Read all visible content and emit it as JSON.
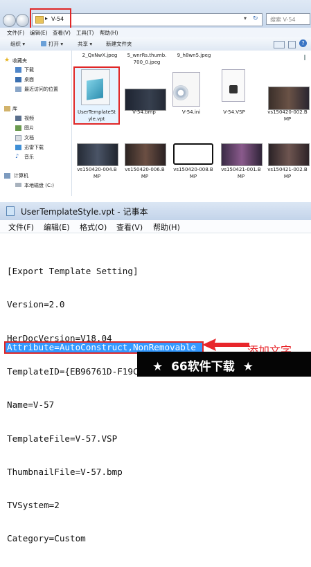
{
  "explorer": {
    "address_segment": "V-54",
    "search_placeholder": "搜索 V-54",
    "menu": [
      "文件(F)",
      "编辑(E)",
      "查看(V)",
      "工具(T)",
      "帮助(H)"
    ],
    "toolbar": {
      "organize": "组织",
      "open": "打开",
      "share": "共享",
      "new_folder": "新建文件夹"
    },
    "nav": {
      "favorites": "收藏夹",
      "downloads": "下载",
      "desktop": "桌面",
      "recent": "最近访问的位置",
      "libraries": "库",
      "videos": "视频",
      "pictures": "图片",
      "documents": "文档",
      "xunlei": "迅雷下载",
      "music": "音乐",
      "computer": "计算机",
      "local_disk": "本地磁盘 (C:)"
    },
    "files_row0": [
      "2_QxNwX.jpeg",
      "5_wnrRs.thumb.",
      "700_0.jpeg",
      "9_h8wn5.jpeg"
    ],
    "files_row1": [
      {
        "l1": "UserTemplateSt",
        "l2": "yle.vpt"
      },
      {
        "l1": "V-54.bmp",
        "l2": ""
      },
      {
        "l1": "V-54.ini",
        "l2": ""
      },
      {
        "l1": "V-54.VSP",
        "l2": ""
      },
      {
        "l1": "vs150420-002.B",
        "l2": "MP"
      }
    ],
    "files_row2": [
      {
        "l1": "vs150420-004.B",
        "l2": "MP"
      },
      {
        "l1": "vs150420-006.B",
        "l2": "MP"
      },
      {
        "l1": "vs150420-008.B",
        "l2": "MP"
      },
      {
        "l1": "vs150421-001.B",
        "l2": "MP"
      },
      {
        "l1": "vs150421-002.B",
        "l2": "MP"
      }
    ]
  },
  "notepad": {
    "title": "UserTemplateStyle.vpt - 记事本",
    "menu": [
      "文件(F)",
      "编辑(E)",
      "格式(O)",
      "查看(V)",
      "帮助(H)"
    ],
    "lines": [
      "[Export Template Setting]",
      "Version=2.0",
      "HerDocVersion=V18.04",
      "TemplateID={EB96761D-F19C-4B7C-A313-3FB34611AB3B}",
      "Name=V-57",
      "TemplateFile=V-57.VSP",
      "ThumbnailFile=V-57.bmp",
      "TVSystem=2",
      "Category=Custom"
    ],
    "selected_line": "Attribute=AutoConstruct,NonRemovable"
  },
  "annotation": "添加文字",
  "watermark": "★  66软件下载  ★",
  "colors": {
    "highlight_red": "#e02626",
    "selection_blue": "#3399ff",
    "arrow_red": "#e8262b"
  }
}
